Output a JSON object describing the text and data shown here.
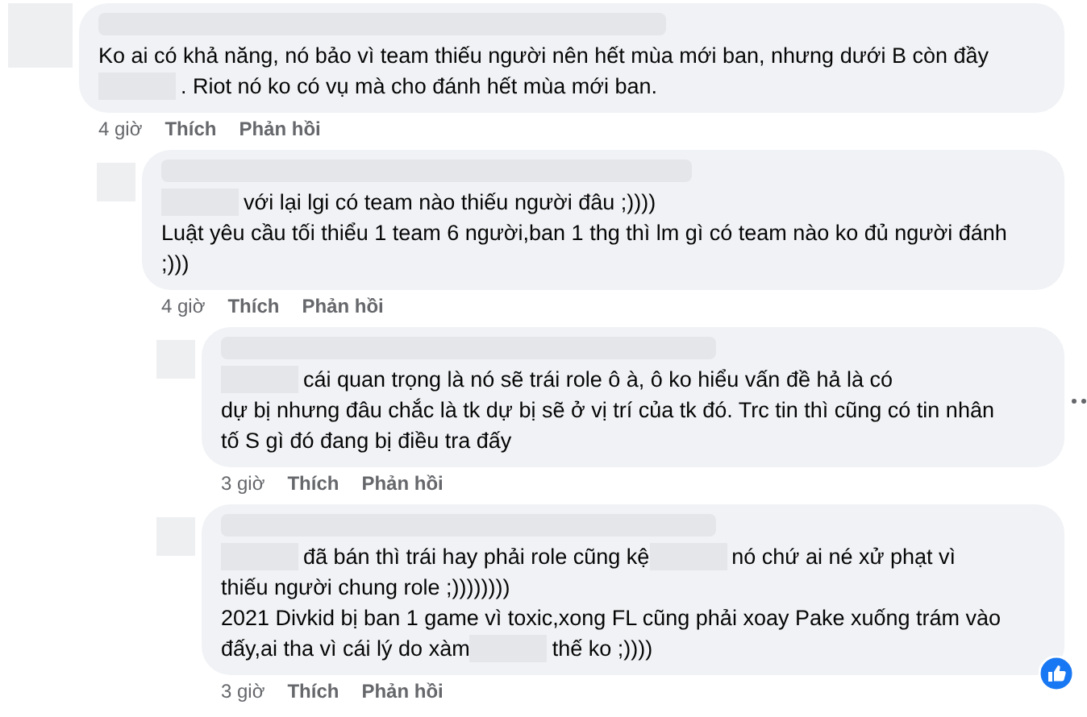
{
  "comments": [
    {
      "lines": [
        [
          {
            "kind": "text",
            "text": "Ko ai có khả năng, nó bảo vì team thiếu người nên hết mùa mới ban, nhưng dưới B còn đầy"
          }
        ],
        [
          {
            "kind": "redacted"
          },
          {
            "kind": "text",
            "text": ". Riot nó ko có vụ mà cho đánh hết mùa mới ban."
          }
        ]
      ],
      "time": "4 giờ",
      "like": "Thích",
      "reply": "Phản hồi",
      "liked": false,
      "more": false,
      "children": [
        {
          "lines": [
            [
              {
                "kind": "redacted"
              },
              {
                "kind": "text",
                "text": "với lại lgi có team nào thiếu người đâu ;))))"
              }
            ],
            [
              {
                "kind": "text",
                "text": "Luật yêu cầu tối thiểu 1 team 6 người,ban 1 thg thì lm gì có team nào ko đủ người đánh"
              }
            ],
            [
              {
                "kind": "text",
                "text": ";)))"
              }
            ]
          ],
          "time": "4 giờ",
          "like": "Thích",
          "reply": "Phản hồi",
          "liked": false,
          "more": false,
          "children": [
            {
              "lines": [
                [
                  {
                    "kind": "redacted"
                  },
                  {
                    "kind": "text",
                    "text": "cái quan trọng là nó sẽ trái role ô à, ô ko hiểu vấn đề hả là có"
                  }
                ],
                [
                  {
                    "kind": "text",
                    "text": "dự bị nhưng đâu chắc là tk dự bị sẽ ở vị trí của tk đó. Trc tin thì cũng có tin nhân"
                  }
                ],
                [
                  {
                    "kind": "text",
                    "text": "tố S gì đó đang bị điều tra đấy"
                  }
                ]
              ],
              "time": "3 giờ",
              "like": "Thích",
              "reply": "Phản hồi",
              "liked": false,
              "more": true
            },
            {
              "lines": [
                [
                  {
                    "kind": "redacted"
                  },
                  {
                    "kind": "text",
                    "text": "đã bán thì trái hay phải role cũng kệ"
                  },
                  {
                    "kind": "redacted"
                  },
                  {
                    "kind": "text",
                    "text": "nó chứ ai né xử phạt vì"
                  }
                ],
                [
                  {
                    "kind": "text",
                    "text": "thiếu người chung role ;))))))))"
                  }
                ],
                [
                  {
                    "kind": "text",
                    "text": "2021 Divkid bị ban 1 game vì toxic,xong FL cũng phải xoay Pake xuống trám vào"
                  }
                ],
                [
                  {
                    "kind": "text",
                    "text": "đấy,ai tha vì cái lý do xàm"
                  },
                  {
                    "kind": "redacted"
                  },
                  {
                    "kind": "text",
                    "text": "thế ko ;))))"
                  }
                ]
              ],
              "time": "3 giờ",
              "like": "Thích",
              "reply": "Phản hồi",
              "liked": true,
              "more": false
            }
          ]
        }
      ]
    }
  ]
}
